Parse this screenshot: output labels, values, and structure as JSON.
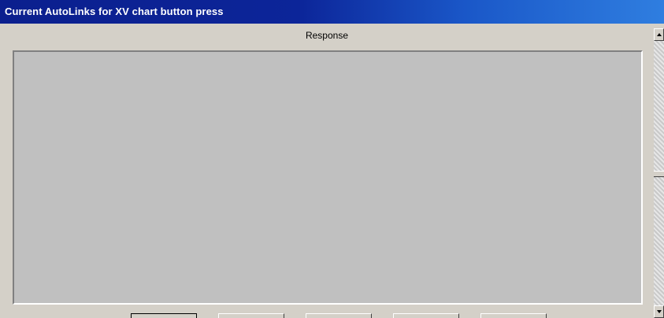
{
  "window": {
    "title": "Current AutoLinks for XV chart button press"
  },
  "table": {
    "column_header": "Response",
    "rows": []
  },
  "buttons": [
    {
      "label": "",
      "default": true
    },
    {
      "label": "",
      "default": false
    },
    {
      "label": "",
      "default": false
    },
    {
      "label": "",
      "default": false
    },
    {
      "label": "",
      "default": false
    }
  ],
  "colors": {
    "titlebar_start": "#0b1f8e",
    "titlebar_end": "#2f7ee0",
    "dialog_face": "#d4d0c8",
    "response_area": "#c0c0c0"
  },
  "icons": {
    "scroll_up": "scroll-up-arrow-icon",
    "scroll_down": "scroll-down-arrow-icon"
  }
}
